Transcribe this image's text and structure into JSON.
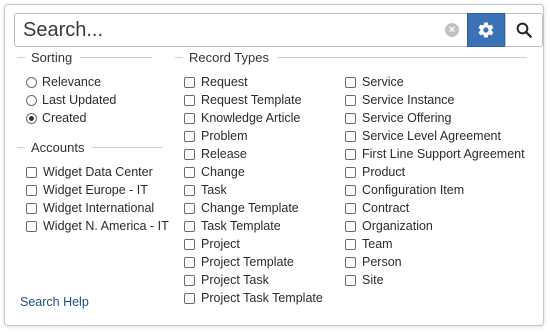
{
  "search": {
    "placeholder": "Search...",
    "clear_icon": "×"
  },
  "colors": {
    "accent": "#3a72b8",
    "link": "#1f4e8c",
    "border": "#c3c7cc"
  },
  "sorting": {
    "title": "Sorting",
    "options": [
      {
        "label": "Relevance",
        "selected": false
      },
      {
        "label": "Last Updated",
        "selected": false
      },
      {
        "label": "Created",
        "selected": true
      }
    ]
  },
  "accounts": {
    "title": "Accounts",
    "items": [
      {
        "label": "Widget Data Center",
        "checked": false
      },
      {
        "label": "Widget Europe - IT",
        "checked": false
      },
      {
        "label": "Widget International",
        "checked": false
      },
      {
        "label": "Widget N. America - IT",
        "checked": false
      }
    ]
  },
  "record_types": {
    "title": "Record Types",
    "col1": [
      {
        "label": "Request",
        "checked": false
      },
      {
        "label": "Request Template",
        "checked": false
      },
      {
        "label": "Knowledge Article",
        "checked": false
      },
      {
        "label": "Problem",
        "checked": false
      },
      {
        "label": "Release",
        "checked": false
      },
      {
        "label": "Change",
        "checked": false
      },
      {
        "label": "Task",
        "checked": false
      },
      {
        "label": "Change Template",
        "checked": false
      },
      {
        "label": "Task Template",
        "checked": false
      },
      {
        "label": "Project",
        "checked": false
      },
      {
        "label": "Project Template",
        "checked": false
      },
      {
        "label": "Project Task",
        "checked": false
      },
      {
        "label": "Project Task Template",
        "checked": false
      }
    ],
    "col2": [
      {
        "label": "Service",
        "checked": false
      },
      {
        "label": "Service Instance",
        "checked": false
      },
      {
        "label": "Service Offering",
        "checked": false
      },
      {
        "label": "Service Level Agreement",
        "checked": false
      },
      {
        "label": "First Line Support Agreement",
        "checked": false
      },
      {
        "label": "Product",
        "checked": false
      },
      {
        "label": "Configuration Item",
        "checked": false
      },
      {
        "label": "Contract",
        "checked": false
      },
      {
        "label": "Organization",
        "checked": false
      },
      {
        "label": "Team",
        "checked": false
      },
      {
        "label": "Person",
        "checked": false
      },
      {
        "label": "Site",
        "checked": false
      }
    ]
  },
  "footer": {
    "help_label": "Search Help"
  }
}
